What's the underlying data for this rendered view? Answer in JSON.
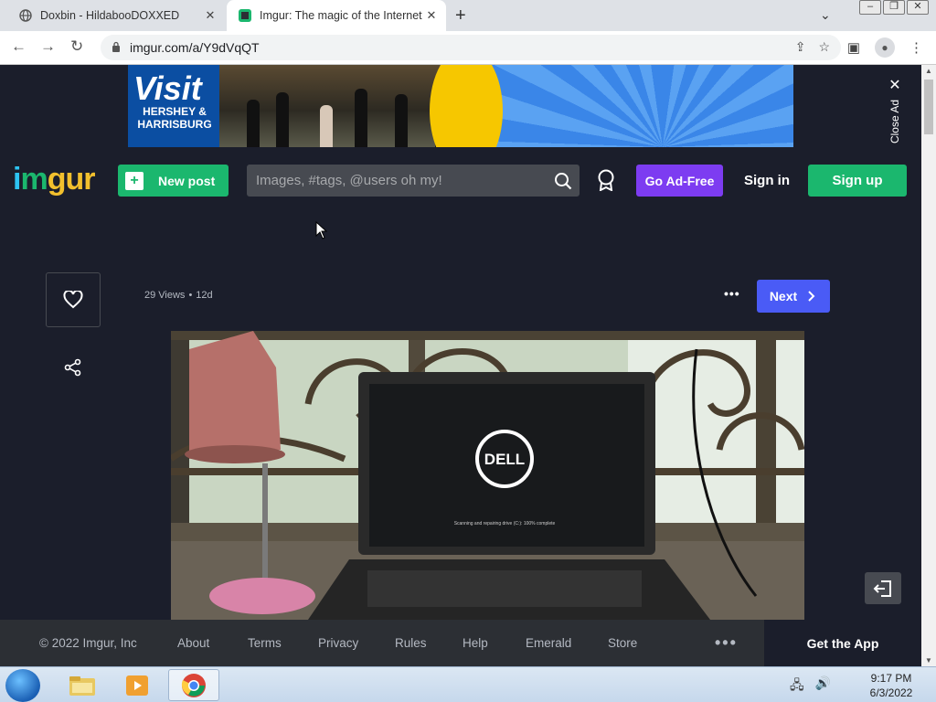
{
  "browser": {
    "tabs": [
      {
        "title": "Doxbin - HildabooDOXXED",
        "active": false
      },
      {
        "title": "Imgur: The magic of the Internet",
        "active": true
      }
    ],
    "url": "imgur.com/a/Y9dVqQT"
  },
  "ad": {
    "headline": "Visit",
    "subline": "HERSHEY & HARRISBURG",
    "close_label": "Close Ad"
  },
  "header": {
    "logo": "imgur",
    "new_post": "New post",
    "search_placeholder": "Images, #tags, @users oh my!",
    "go_ad_free": "Go Ad-Free",
    "sign_in": "Sign in",
    "sign_up": "Sign up"
  },
  "post": {
    "views": "29 Views",
    "age": "12d",
    "next": "Next",
    "screen_text": "Scanning and repairing drive (C:): 100% complete",
    "laptop_logo": "DELL"
  },
  "footer": {
    "copyright": "© 2022 Imgur, Inc",
    "links": [
      "About",
      "Terms",
      "Privacy",
      "Rules",
      "Help",
      "Emerald",
      "Store"
    ],
    "more": "•••",
    "get_app": "Get the App"
  },
  "taskbar": {
    "time": "9:17 PM",
    "date": "6/3/2022"
  },
  "colors": {
    "page_bg": "#1b1e2b",
    "green": "#1bb76e",
    "purple": "#7d3cf1",
    "next_blue": "#4a5bf6"
  }
}
